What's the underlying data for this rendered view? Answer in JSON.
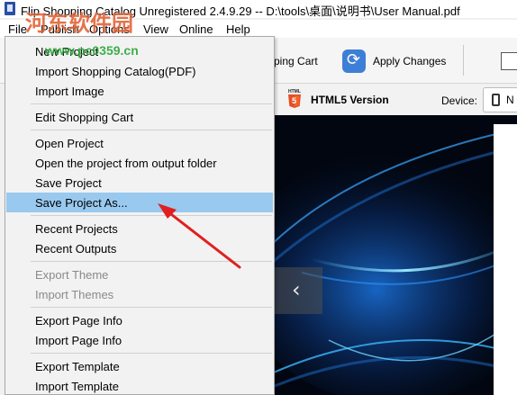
{
  "window": {
    "title": "Flip Shopping Catalog Unregistered 2.4.9.29 -- D:\\tools\\桌面\\说明书\\User Manual.pdf"
  },
  "watermark": {
    "brand": "河东软件园",
    "url": "www.pc0359.cn"
  },
  "menubar": {
    "items": [
      {
        "label": "File"
      },
      {
        "label": "Publish"
      },
      {
        "label": "Options"
      },
      {
        "label": "View"
      },
      {
        "label": "Online"
      },
      {
        "label": "Help"
      }
    ]
  },
  "toolbar": {
    "cart_partial_label": "ping Cart",
    "apply_label": "Apply Changes"
  },
  "preview": {
    "version_label": "HTML5 Version",
    "device_label": "Device:",
    "device_value": "N",
    "prev_glyph": "‹"
  },
  "file_menu": {
    "items": [
      {
        "label": "New Project",
        "enabled": true
      },
      {
        "label": "Import Shopping Catalog(PDF)",
        "enabled": true
      },
      {
        "label": "Import Image",
        "enabled": true
      },
      {
        "label": "Edit Shopping Cart",
        "enabled": true
      },
      {
        "label": "Open Project",
        "enabled": true
      },
      {
        "label": "Open the project from output folder",
        "enabled": true
      },
      {
        "label": "Save Project",
        "enabled": true
      },
      {
        "label": "Save Project As...",
        "enabled": true,
        "selected": true
      },
      {
        "label": "Recent Projects",
        "enabled": true
      },
      {
        "label": "Recent Outputs",
        "enabled": true
      },
      {
        "label": "Export Theme",
        "enabled": false
      },
      {
        "label": "Import Themes",
        "enabled": false
      },
      {
        "label": "Export Page Info",
        "enabled": true
      },
      {
        "label": "Import Page Info",
        "enabled": true
      },
      {
        "label": "Export Template",
        "enabled": true
      },
      {
        "label": "Import Template",
        "enabled": true
      }
    ]
  },
  "colors": {
    "selection": "#99c9ef",
    "annotation_arrow": "#e02020",
    "watermark_brand": "#e25b2c",
    "watermark_url": "#2ba83a"
  }
}
